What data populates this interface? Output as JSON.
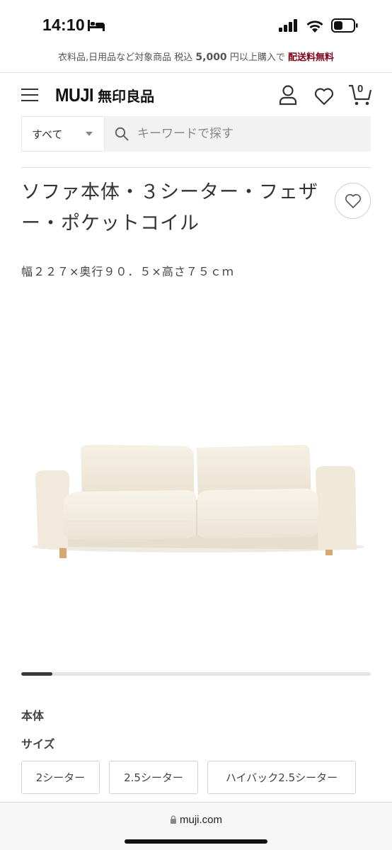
{
  "status_bar": {
    "time": "14:10"
  },
  "promo": {
    "text_prefix": "衣料品,日用品など対象商品 税込",
    "amount": "5,000",
    "text_mid": "円以上購入で",
    "highlight": "配送料無料"
  },
  "header": {
    "logo_en": "MUJI",
    "logo_jp": "無印良品",
    "cart_count": "0"
  },
  "search": {
    "category": "すべて",
    "placeholder": "キーワードで探す"
  },
  "product": {
    "title": "ソファ本体・３シーター・フェザー・ポケットコイル",
    "dimensions": "幅２２７×奥行９０．５×高さ７５ｃｍ"
  },
  "gallery": {
    "progress": 0.09
  },
  "options": {
    "section_label": "本体",
    "size_label": "サイズ",
    "sizes": [
      "2シーター",
      "2.5シーター",
      "ハイバック2.5シーター"
    ]
  },
  "browser": {
    "url": "muji.com"
  },
  "colors": {
    "accent": "#7f0019",
    "sofa": "#f3ede1",
    "legs": "#d7a774"
  }
}
